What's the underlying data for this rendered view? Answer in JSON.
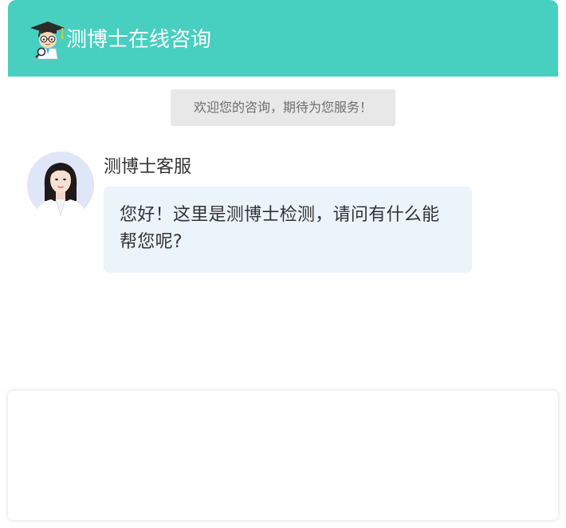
{
  "header": {
    "title": "测博士在线咨询",
    "logo_icon": "doctor-mascot-icon",
    "background_color": "#47cfc0"
  },
  "system_notice": {
    "text": "欢迎您的咨询，期待为您服务！"
  },
  "messages": [
    {
      "sender": "测博士客服",
      "avatar_icon": "agent-avatar",
      "text": "您好！这里是测博士检测，请问有什么能帮您呢?"
    }
  ],
  "composer": {
    "value": "",
    "placeholder": ""
  }
}
